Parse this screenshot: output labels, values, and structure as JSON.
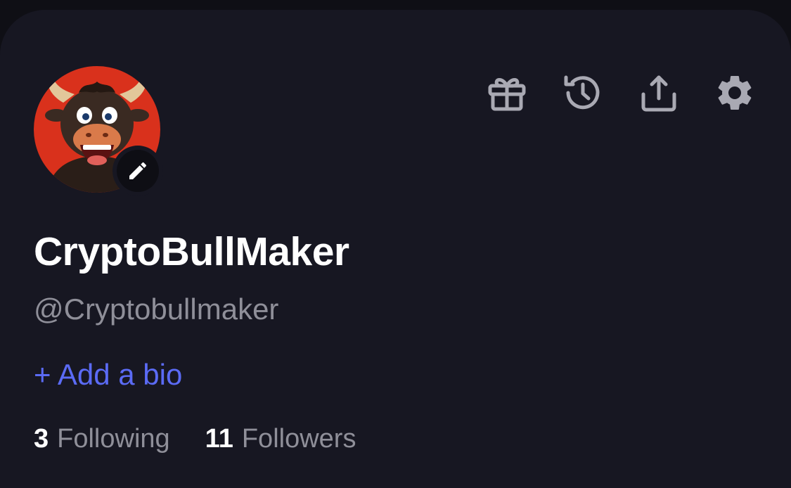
{
  "profile": {
    "display_name": "CryptoBullMaker",
    "handle": "@Cryptobullmaker",
    "add_bio_label": "+ Add a bio",
    "avatar_description": "cartoon bull avatar",
    "edit_icon": "pencil-icon"
  },
  "toolbar": {
    "icons": [
      "gift-icon",
      "history-icon",
      "share-icon",
      "gear-icon"
    ]
  },
  "stats": {
    "following_count": "3",
    "following_label": "Following",
    "followers_count": "11",
    "followers_label": "Followers"
  },
  "colors": {
    "background": "#171722",
    "accent": "#5b6bf5",
    "muted_text": "#8f8f99",
    "icon": "#a9a9b3",
    "avatar_bg": "#d9311c"
  }
}
